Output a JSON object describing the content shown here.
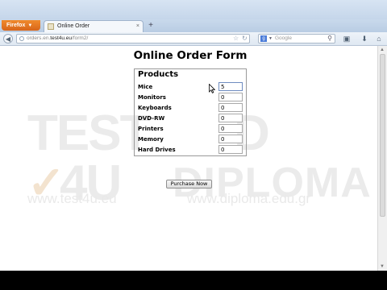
{
  "browser": {
    "app_button_label": "Firefox",
    "tab_title": "Online Order",
    "url_prefix": "orders.en.",
    "url_domain": "test4u.eu",
    "url_path": "/form2/",
    "search_placeholder": "Google"
  },
  "watermark": {
    "line1_left": "TEST",
    "line2_left": "4U",
    "line1_right": "D",
    "line2_right": "DIPLOMA",
    "url_left": "www.test4u.eu",
    "url_right": "www.diploma.edu.gr"
  },
  "form": {
    "title": "Online Order Form",
    "legend": "Products",
    "items": [
      {
        "label": "Mice",
        "value": "5"
      },
      {
        "label": "Monitors",
        "value": "0"
      },
      {
        "label": "Keyboards",
        "value": "0"
      },
      {
        "label": "DVD-RW",
        "value": "0"
      },
      {
        "label": "Printers",
        "value": "0"
      },
      {
        "label": "Memory",
        "value": "0"
      },
      {
        "label": "Hard Drives",
        "value": "0"
      }
    ],
    "submit_label": "Purchase Now"
  },
  "icons": {
    "back": "back-arrow-icon",
    "star": "bookmark-star-icon",
    "reload": "reload-icon",
    "search": "magnifier-icon",
    "bookmarks": "bookmarks-menu-icon",
    "download": "download-arrow-icon",
    "home": "home-icon"
  }
}
